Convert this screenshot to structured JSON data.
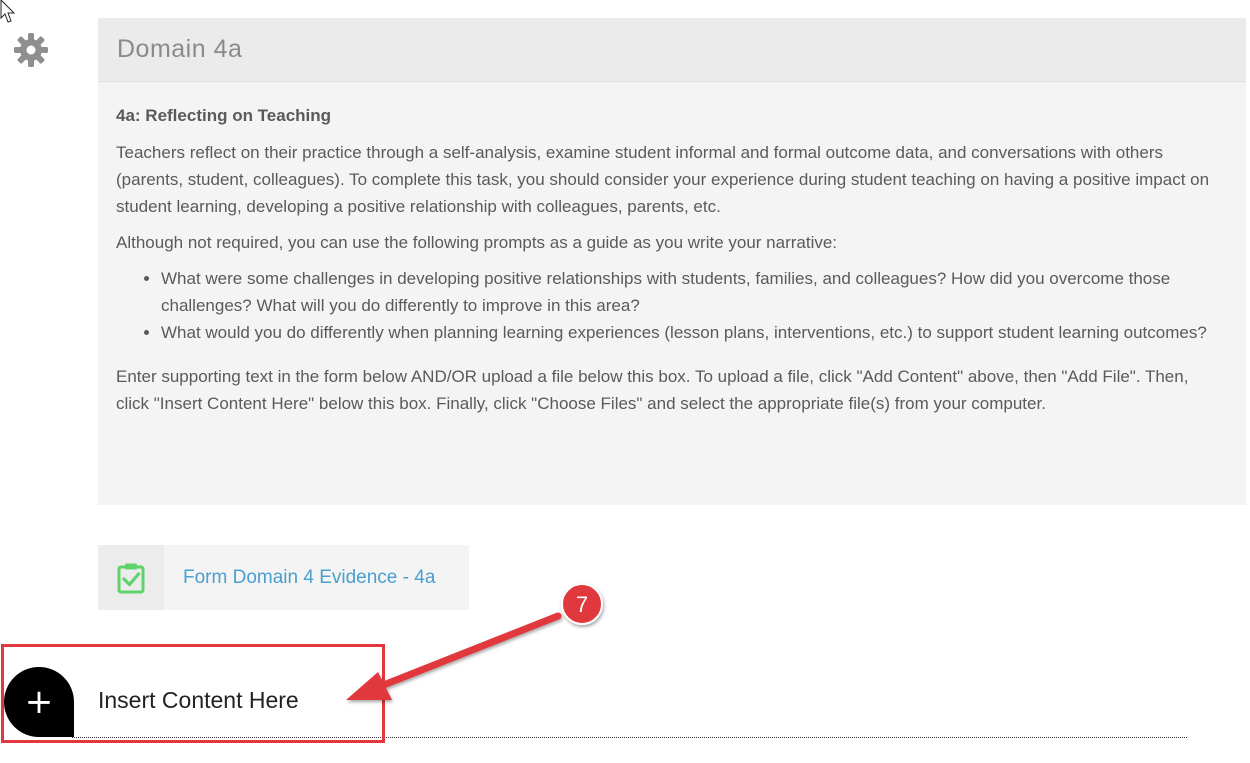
{
  "panel": {
    "title": "Domain 4a",
    "heading": "4a: Reflecting on Teaching",
    "intro": "Teachers reflect on their practice through a self-analysis, examine student informal and formal outcome data, and conversations with others (parents, student, colleagues). To complete this task, you should consider your experience during student teaching on having a positive impact on student learning, developing a positive relationship with colleagues, parents, etc.",
    "prompt_lead": "Although not required, you can use the following prompts as a guide as you write your narrative:",
    "prompts": [
      "What were some challenges in developing positive relationships with students, families, and colleagues? How did you overcome those challenges? What will you do differently to improve in this area?",
      "What would you do differently when planning learning experiences (lesson plans, interventions, etc.) to support student learning outcomes?"
    ],
    "instructions": "Enter supporting text in the form below AND/OR upload a file below this box.  To upload a file, click \"Add Content\" above, then \"Add File\".  Then, click \"Insert Content Here\" below this box.  Finally, click \"Choose Files\" and select the appropriate file(s) from your computer."
  },
  "form_item": {
    "label": "Form Domain 4 Evidence - 4a",
    "icon": "clipboard-check-icon"
  },
  "insert": {
    "label": "Insert Content Here",
    "icon": "plus-icon"
  },
  "annotation": {
    "step_number": "7"
  },
  "colors": {
    "link": "#4a9fd0",
    "form_icon": "#5fd36b",
    "annotation_red": "#e0383c"
  }
}
